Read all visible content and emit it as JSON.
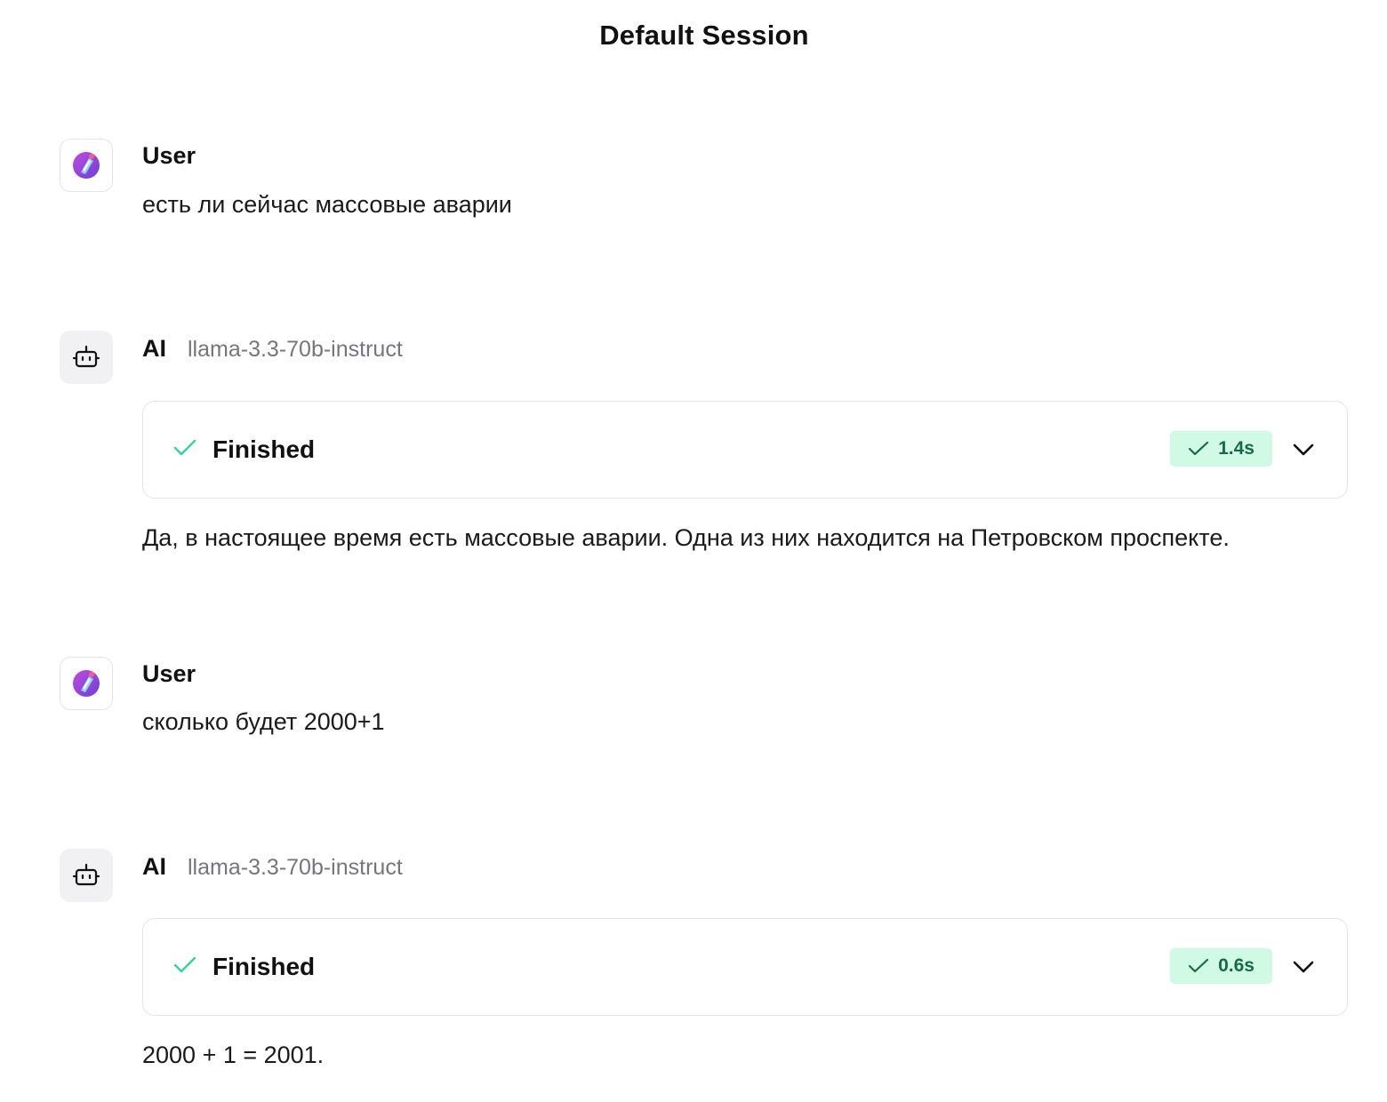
{
  "session": {
    "title": "Default Session"
  },
  "messages": [
    {
      "role": "user",
      "sender": "User",
      "text": "есть ли сейчас массовые аварии"
    },
    {
      "role": "ai",
      "sender": "AI",
      "model": "llama-3.3-70b-instruct",
      "status": "Finished",
      "duration": "1.4s",
      "text": "Да, в настоящее время есть массовые аварии. Одна из них находится на Петровском проспекте."
    },
    {
      "role": "user",
      "sender": "User",
      "text": "сколько будет 2000+1"
    },
    {
      "role": "ai",
      "sender": "AI",
      "model": "llama-3.3-70b-instruct",
      "status": "Finished",
      "duration": "0.6s",
      "text": "2000 + 1 = 2001."
    }
  ],
  "icons": {
    "user_avatar": "astronaut-avatar-icon",
    "ai_avatar": "bot-icon",
    "status_check": "check-icon",
    "expand": "chevron-down-icon"
  },
  "colors": {
    "success_green": "#34d399",
    "badge_bg": "#d1fae5",
    "badge_text": "#166a4a",
    "model_gray": "#75757d",
    "avatar_purple": "#9b3fd8"
  }
}
